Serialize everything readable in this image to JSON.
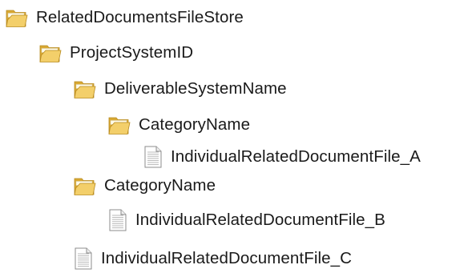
{
  "tree": {
    "root": {
      "label": "RelatedDocumentsFileStore",
      "icon": "folder-icon",
      "children": [
        {
          "label": "ProjectSystemID",
          "icon": "folder-icon",
          "children": [
            {
              "label": "DeliverableSystemName",
              "icon": "folder-icon",
              "children": [
                {
                  "label": "CategoryName",
                  "icon": "folder-icon",
                  "children": [
                    {
                      "label": "IndividualRelatedDocumentFile_A",
                      "icon": "file-icon"
                    }
                  ]
                }
              ]
            },
            {
              "label": "CategoryName",
              "icon": "folder-icon",
              "children": [
                {
                  "label": "IndividualRelatedDocumentFile_B",
                  "icon": "file-icon"
                }
              ]
            },
            {
              "label": "IndividualRelatedDocumentFile_C",
              "icon": "file-icon"
            }
          ]
        }
      ]
    }
  },
  "colors": {
    "folder_back": "#d9a934",
    "folder_front": "#f3cf6a",
    "folder_edge": "#b88a1e",
    "file_page": "#ffffff",
    "file_edge": "#8c8c8c",
    "file_lines": "#b8b8b8",
    "text": "#1a1a1a"
  }
}
